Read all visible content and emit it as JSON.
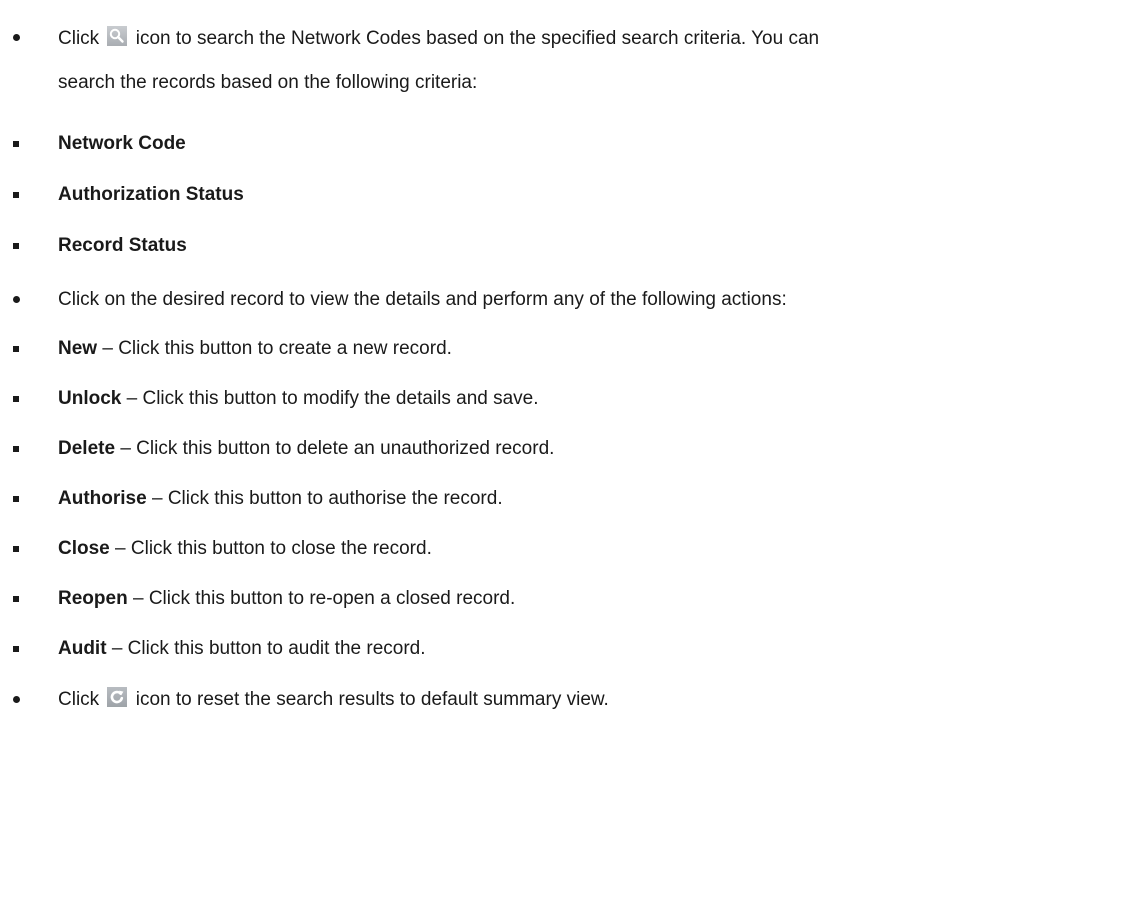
{
  "para1": {
    "pre": "Click",
    "icon": "search-icon",
    "post": "icon to search the Network Codes based on the specified search criteria. You can",
    "cont": "search the records based on the following criteria:"
  },
  "criteria": [
    "Network Code",
    "Authorization Status",
    "Record Status"
  ],
  "para2": "Click on the desired record to view the details and perform any of the following actions:",
  "actions": [
    {
      "name": "New",
      "desc": "– Click this button to create a new record."
    },
    {
      "name": "Unlock",
      "desc": "– Click this button to modify the details and save."
    },
    {
      "name": "Delete",
      "desc": "– Click this button to delete an unauthorized record."
    },
    {
      "name": "Authorise",
      "desc": "– Click this button to authorise the record."
    },
    {
      "name": "Close",
      "desc": "– Click this button to close the record."
    },
    {
      "name": "Reopen",
      "desc": "– Click this button to re-open a closed record."
    },
    {
      "name": "Audit",
      "desc": "– Click this button to audit the record."
    }
  ],
  "para3": {
    "pre": "Click",
    "icon": "reset-icon",
    "post": "icon to reset the search results to default summary view."
  }
}
